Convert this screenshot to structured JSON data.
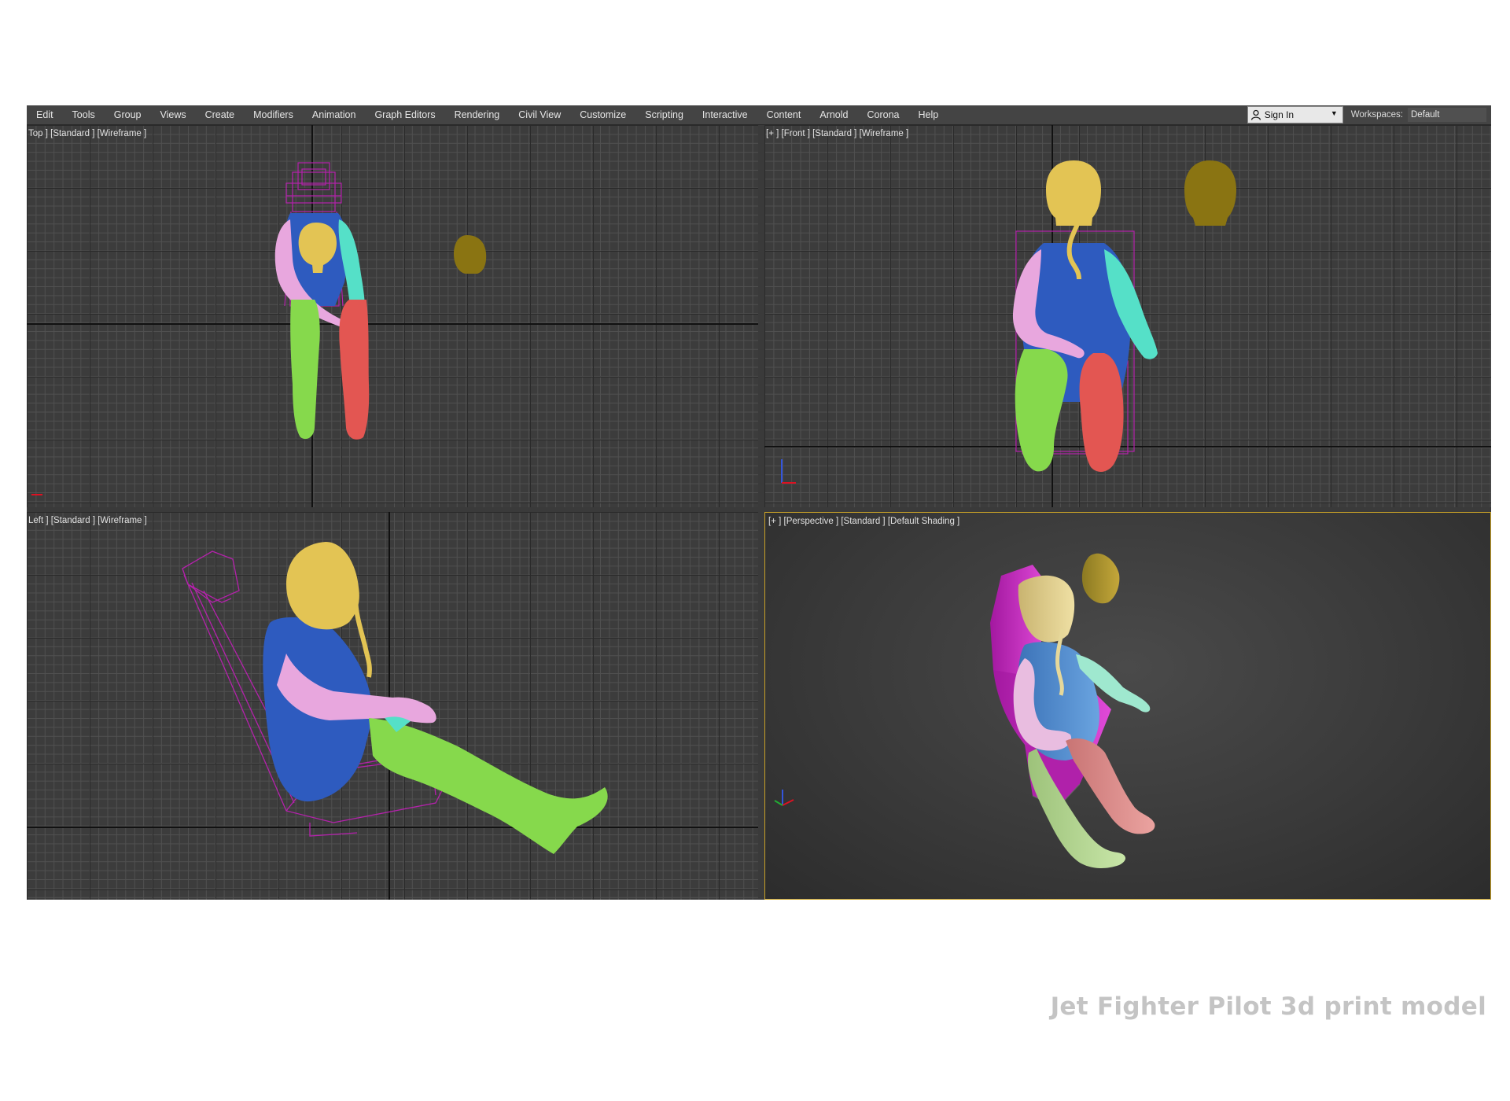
{
  "menubar": {
    "items": [
      {
        "label": "Edit"
      },
      {
        "label": "Tools"
      },
      {
        "label": "Group"
      },
      {
        "label": "Views"
      },
      {
        "label": "Create"
      },
      {
        "label": "Modifiers"
      },
      {
        "label": "Animation"
      },
      {
        "label": "Graph Editors"
      },
      {
        "label": "Rendering"
      },
      {
        "label": "Civil View"
      },
      {
        "label": "Customize"
      },
      {
        "label": "Scripting"
      },
      {
        "label": "Interactive"
      },
      {
        "label": "Content"
      },
      {
        "label": "Arnold"
      },
      {
        "label": "Corona"
      },
      {
        "label": "Help"
      }
    ],
    "sign_in_label": "Sign In",
    "workspaces_label": "Workspaces:",
    "workspaces_value": "Default"
  },
  "viewports": {
    "top_label": "Top ] [Standard ] [Wireframe ]",
    "front_label": "[+ ] [Front ] [Standard ] [Wireframe ]",
    "left_label": "Left ] [Standard ] [Wireframe ]",
    "perspective_label": "[+ ] [Perspective ] [Standard ] [Default Shading ]"
  },
  "colors": {
    "head": "#e3c454",
    "torso": "#2e5bbf",
    "left_arm": "#e8a7de",
    "right_arm": "#55e0c8",
    "left_leg": "#86d94c",
    "right_leg": "#e35652",
    "seat": "#c21fb8",
    "spare_head": "#8a7412",
    "viewport_active_border": "#c9a227"
  },
  "caption": "Jet Fighter Pilot 3d print model"
}
